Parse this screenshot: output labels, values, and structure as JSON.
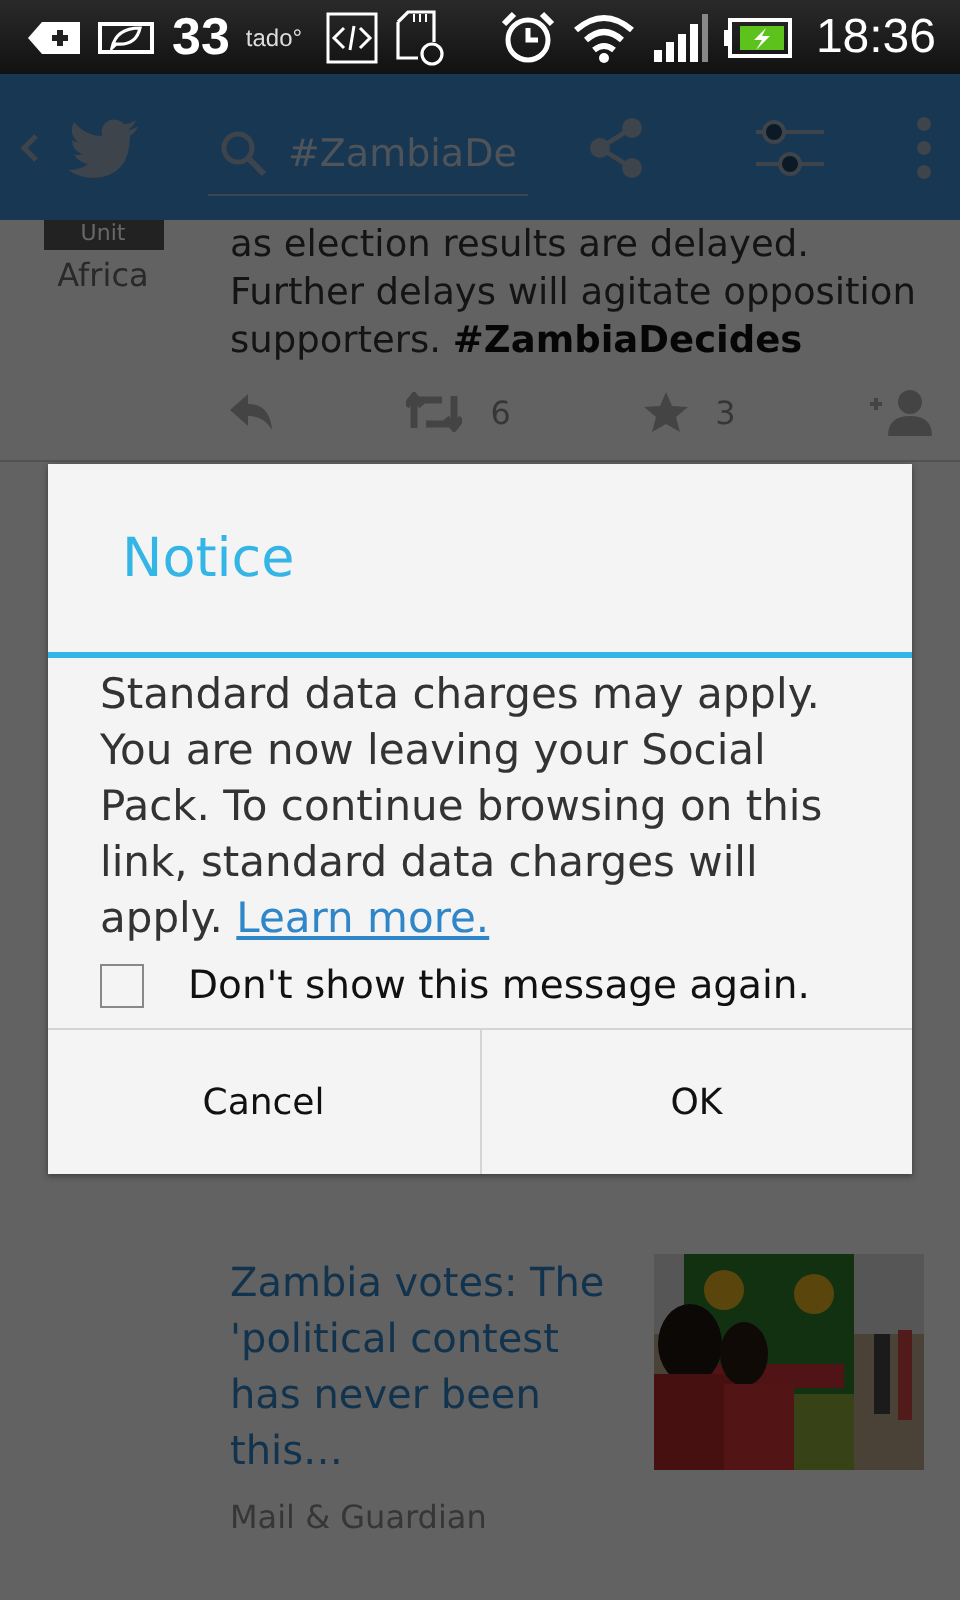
{
  "status_bar": {
    "temperature": "33",
    "app_label": "tado°",
    "time": "18:36"
  },
  "app_bar": {
    "search_query": "#ZambiaDe"
  },
  "tweet": {
    "avatar_caption": "Unit",
    "author_label": "Africa",
    "text": "as election results are delayed. Further delays will agitate opposition supporters. **#ZambiaDecides**",
    "retweets": "6",
    "favorites": "3"
  },
  "card": {
    "title": "Zambia votes: The 'political contest has never been this…",
    "source": "Mail & Guardian"
  },
  "dialog": {
    "title": "Notice",
    "message": "Standard data charges may apply. You are now leaving your Social Pack. To continue browsing on this link, standard data charges will apply.",
    "link": "Learn more.",
    "checkbox": {
      "label": "Don't show this message again.",
      "checked": false
    },
    "buttons": [
      "Cancel",
      "OK"
    ]
  }
}
